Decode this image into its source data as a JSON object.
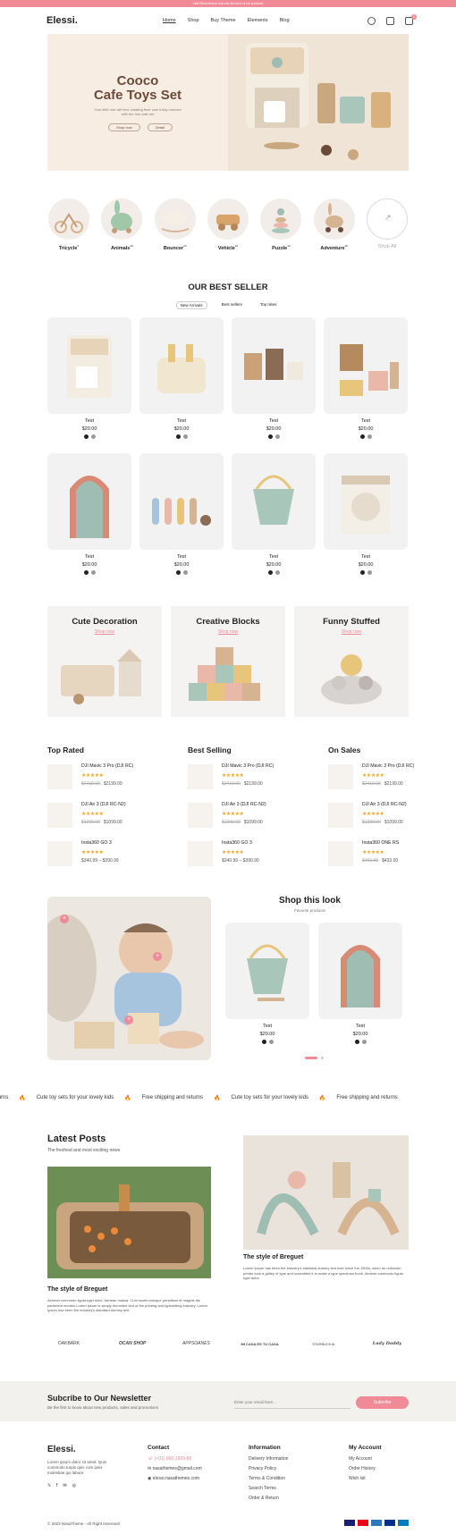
{
  "topbar": {
    "text": "Visit Elessi theme and see the best of our products"
  },
  "header": {
    "logo": "Elessi.",
    "nav": [
      "Home",
      "Shop",
      "Buy Theme",
      "Elements",
      "Blog"
    ],
    "cart_count": "0"
  },
  "hero": {
    "title_line1": "Cooco",
    "title_line2": "Cafe Toys Set",
    "subtitle": "Your little one will love creating their own tricky courses with the Inio cafe set",
    "btn1": "Shop now",
    "btn2": "Detail"
  },
  "categories": [
    {
      "label": "Tricycle",
      "count": "4"
    },
    {
      "label": "Animals",
      "count": "10"
    },
    {
      "label": "Bouncer",
      "count": "10"
    },
    {
      "label": "Vehicle",
      "count": "10"
    },
    {
      "label": "Puzzle",
      "count": "10"
    },
    {
      "label": "Adventure",
      "count": "10"
    },
    {
      "label": "Shop All",
      "count": ""
    }
  ],
  "best_seller": {
    "title": "OUR BEST SELLER",
    "tabs": [
      "New Arrivals",
      "Best sellers",
      "Top rates"
    ],
    "products": [
      {
        "name": "Test",
        "price": "$20.00"
      },
      {
        "name": "Test",
        "price": "$20.00"
      },
      {
        "name": "Test",
        "price": "$20.00"
      },
      {
        "name": "Test",
        "price": "$20.00"
      },
      {
        "name": "Test",
        "price": "$20.00"
      },
      {
        "name": "Test",
        "price": "$20.00"
      },
      {
        "name": "Test",
        "price": "$20.00"
      },
      {
        "name": "Test",
        "price": "$20.00"
      }
    ]
  },
  "banners": [
    {
      "title": "Cute Decoration",
      "link": "Shop now"
    },
    {
      "title": "Creative Blocks",
      "link": "Shop now"
    },
    {
      "title": "Funny Stuffed",
      "link": "Shop now"
    }
  ],
  "lists": [
    {
      "title": "Top Rated",
      "items": [
        {
          "name": "DJI Mavic 3 Pro (DJI RC)",
          "old": "$2419.00",
          "price": "$2199.00"
        },
        {
          "name": "DJI Air 3 (DJI RC-N2)",
          "old": "$1299.00",
          "price": "$1099.00"
        },
        {
          "name": "Insta360 GO 3",
          "old": "",
          "price": "$340.99 – $390.99"
        }
      ]
    },
    {
      "title": "Best Selling",
      "items": [
        {
          "name": "DJI Mavic 3 Pro (DJI RC)",
          "old": "$2419.00",
          "price": "$2199.00"
        },
        {
          "name": "DJI Air 3 (DJI RC-N2)",
          "old": "$1299.00",
          "price": "$1099.00"
        },
        {
          "name": "Insta360 GO 3",
          "old": "",
          "price": "$340.99 – $390.99"
        }
      ]
    },
    {
      "title": "On Sales",
      "items": [
        {
          "name": "DJI Mavic 3 Pro (DJI RC)",
          "old": "$2419.00",
          "price": "$2199.00"
        },
        {
          "name": "DJI Air 3 (DJI RC-N2)",
          "old": "$1299.00",
          "price": "$1099.00"
        },
        {
          "name": "Insta360 ONE RS",
          "old": "$469.99",
          "price": "$433.00"
        }
      ]
    }
  ],
  "stars": "★★★★★",
  "look": {
    "title": "Shop this look",
    "sub": "Favorite products",
    "products": [
      {
        "name": "Test",
        "price": "$20.00"
      },
      {
        "name": "Test",
        "price": "$20.00"
      }
    ]
  },
  "marquee": [
    "turns",
    "Cute toy sets for your lovely kids",
    "Free shipping and returns",
    "Cute toy sets for your lovely kids",
    "Free shipping and returns"
  ],
  "posts": {
    "title": "Latest Posts",
    "sub": "The freshest and most exciting news",
    "p1_title": "The style of Breguet",
    "p1_text": "Aenean commodo ligula eget dolor. Aenean massa. Cum sociis natoque penatibus et magnis dis parturient montes Lorem ipsum is simply dummied text of the printing and typesetting industry. Lorem Ipsum has been the industry's standard dummy text",
    "p2_title": "The style of Breguet",
    "p2_text": "Lorem Ipsum has been the industry's standard dummy text ever since the 1500s, when an unknown printer took a galley of type and scrambled it to make a type specimen book. Aenean commodo ligula eget dolor."
  },
  "brands": [
    "OAKBARK",
    "OCAN SHOP",
    "APPSOANES",
    "MI CASA ES TU CASA",
    "STARBUCKIA",
    "Lady Daddy"
  ],
  "newsletter": {
    "title": "Subcribe to Our Newsletter",
    "sub": "Be the first to know about new products, sales and promotions",
    "placeholder": "Enter your email here...",
    "btn": "Subcribe"
  },
  "footer": {
    "logo": "Elessi.",
    "about": "Lorem ipsum dolor sit amet. Quis commodo turpis quis cum ipsis molestiae qui labore.",
    "contact_h": "Contact",
    "contact": [
      "(+01) 800-1999-88",
      "nasathemes@gmail.com",
      "elessi.nasathemes.com"
    ],
    "info_h": "Information",
    "info": [
      "Delivery Information",
      "Privacy Policy",
      "Terms & Condition",
      "Search Terms",
      "Order & Return"
    ],
    "acc_h": "My Account",
    "acc": [
      "My Account",
      "Order History",
      "Wish list"
    ],
    "copy": "© 2023 NasaTheme - All Right reserved!"
  },
  "colors": {
    "accent": "#f08a96",
    "star": "#f5a623"
  }
}
